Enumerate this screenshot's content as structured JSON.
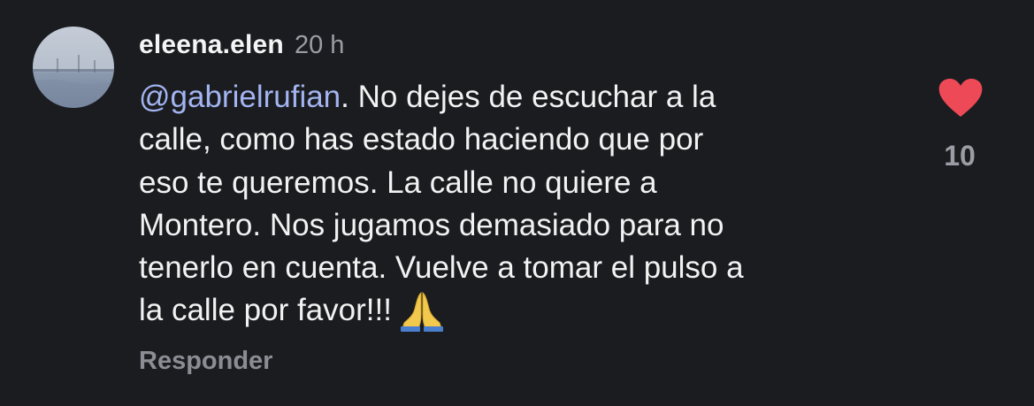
{
  "comment": {
    "username": "eleena.elen",
    "timestamp": "20 h",
    "mention": "@gabrielrufian",
    "lines": [
      ". No dejes de escuchar a la",
      "calle, como has estado haciendo que por",
      "eso te queremos. La calle no quiere a",
      "Montero. Nos jugamos demasiado para no",
      "tenerlo en cuenta. Vuelve a tomar el pulso a",
      "la calle por favor!!!"
    ],
    "emoji": "folded-hands-emoji",
    "reply_label": "Responder",
    "like_icon": "heart-icon",
    "like_count": "10"
  },
  "colors": {
    "background": "#1a1c20",
    "mention": "#a3b4f0",
    "heart": "#ed4956",
    "secondary_text": "#9a9da3"
  }
}
